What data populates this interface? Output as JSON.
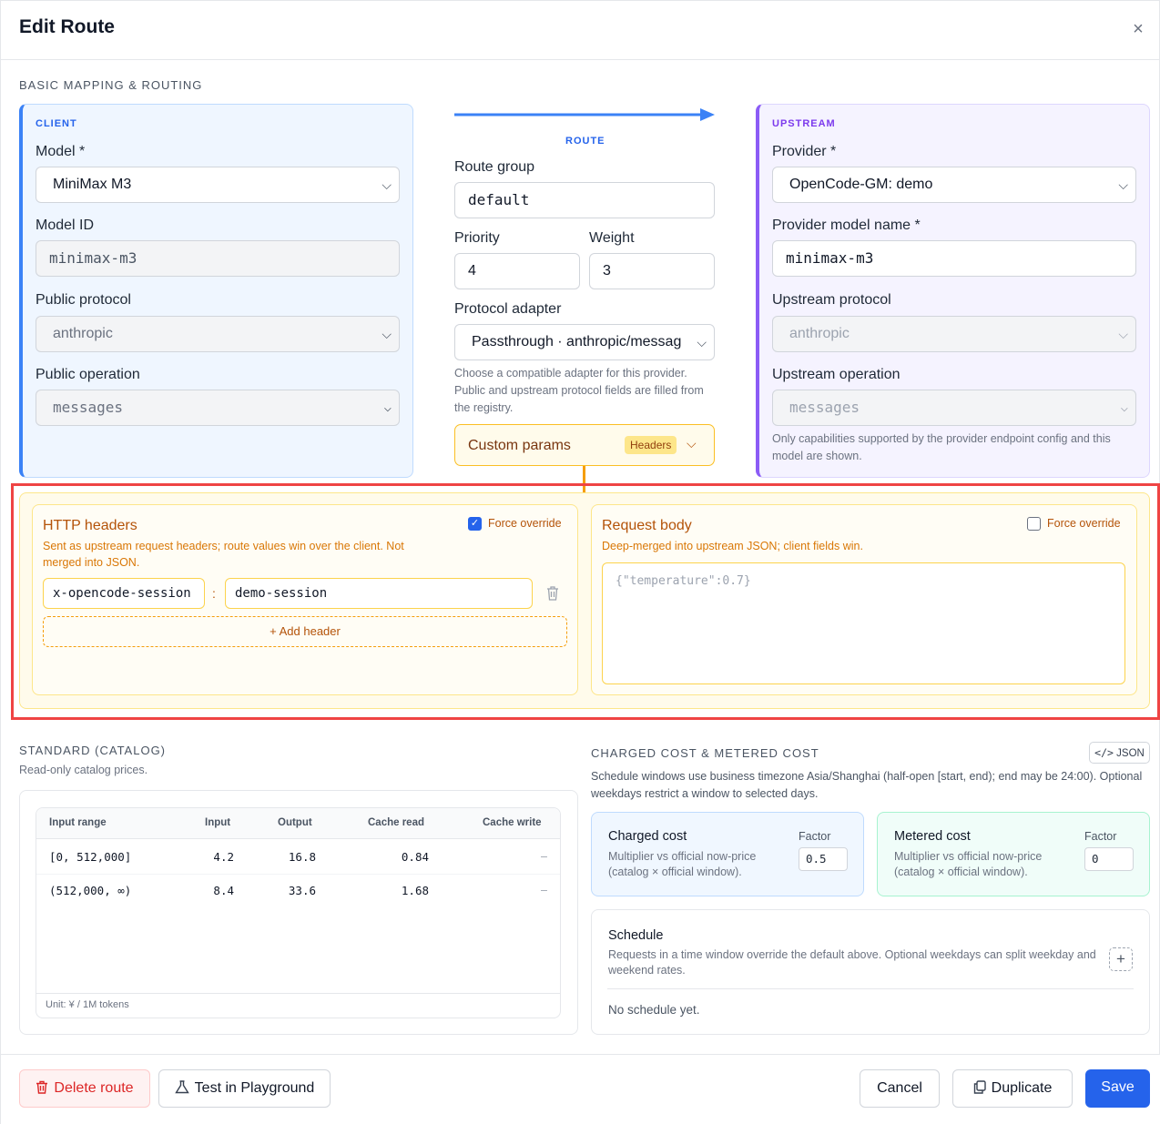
{
  "dialog": {
    "title": "Edit Route",
    "close_glyph": "×"
  },
  "basic": {
    "section": "BASIC MAPPING & ROUTING",
    "client": {
      "tag": "CLIENT",
      "model_label": "Model *",
      "model_value": "MiniMax M3",
      "model_id_label": "Model ID",
      "model_id_value": "minimax-m3",
      "public_protocol_label": "Public protocol",
      "public_protocol_value": "anthropic",
      "public_operation_label": "Public operation",
      "public_operation_value": "messages"
    },
    "route": {
      "tag": "ROUTE",
      "group_label": "Route group",
      "group_value": "default",
      "priority_label": "Priority",
      "priority_value": "4",
      "weight_label": "Weight",
      "weight_value": "3",
      "adapter_label": "Protocol adapter",
      "adapter_value": "Passthrough · anthropic/messag",
      "adapter_hint": "Choose a compatible adapter for this provider. Public and upstream protocol fields are filled from the registry.",
      "custom_params_label": "Custom params",
      "custom_params_badge": "Headers"
    },
    "upstream": {
      "tag": "UPSTREAM",
      "provider_label": "Provider *",
      "provider_value": "OpenCode-GM: demo",
      "model_name_label": "Provider model name *",
      "model_name_value": "minimax-m3",
      "protocol_label": "Upstream protocol",
      "protocol_value": "anthropic",
      "operation_label": "Upstream operation",
      "operation_value": "messages",
      "hint": "Only capabilities supported by the provider endpoint config and this model are shown."
    }
  },
  "custom": {
    "headers": {
      "title": "HTTP headers",
      "force_label": "Force override",
      "force_checked": true,
      "desc": "Sent as upstream request headers; route values win over the client. Not merged into JSON.",
      "rows": [
        {
          "key": "x-opencode-session",
          "sep": ":",
          "value": "demo-session"
        }
      ],
      "add_label": "+ Add header"
    },
    "body": {
      "title": "Request body",
      "force_label": "Force override",
      "force_checked": false,
      "desc": "Deep-merged into upstream JSON; client fields win.",
      "placeholder": "{\"temperature\":0.7}"
    }
  },
  "catalog": {
    "section": "STANDARD (CATALOG)",
    "desc": "Read-only catalog prices.",
    "columns": [
      "Input range",
      "Input",
      "Output",
      "Cache read",
      "Cache write"
    ],
    "rows": [
      [
        "[0, 512,000]",
        "4.2",
        "16.8",
        "0.84",
        "–"
      ],
      [
        "(512,000, ∞)",
        "8.4",
        "33.6",
        "1.68",
        "–"
      ]
    ],
    "unit": "Unit: ¥ / 1M tokens"
  },
  "cost": {
    "section": "CHARGED COST & METERED COST",
    "json_button": "JSON",
    "desc": "Schedule windows use business timezone Asia/Shanghai (half-open [start, end); end may be 24:00). Optional weekdays restrict a window to selected days.",
    "charged": {
      "title": "Charged cost",
      "desc": "Multiplier vs official now-price (catalog × official window).",
      "factor_label": "Factor",
      "factor_value": "0.5"
    },
    "metered": {
      "title": "Metered cost",
      "desc": "Multiplier vs official now-price (catalog × official window).",
      "factor_label": "Factor",
      "factor_value": "0"
    },
    "schedule": {
      "title": "Schedule",
      "desc": "Requests in a time window override the default above. Optional weekdays can split weekday and weekend rates.",
      "empty": "No schedule yet.",
      "add_glyph": "+"
    }
  },
  "footer": {
    "delete": "Delete route",
    "test": "Test in Playground",
    "cancel": "Cancel",
    "duplicate": "Duplicate",
    "save": "Save"
  },
  "colors": {
    "accent": "#2563eb",
    "client": "#3b82f6",
    "upstream": "#8b5cf6",
    "custom": "#f59e0b",
    "danger": "#dc2626",
    "highlight": "#ef4444"
  }
}
